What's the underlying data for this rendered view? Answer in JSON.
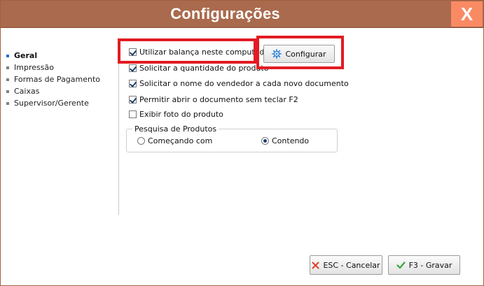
{
  "window": {
    "title": "Configurações",
    "close_label": "X"
  },
  "sidebar": {
    "items": [
      {
        "label": "Geral",
        "active": true
      },
      {
        "label": "Impressão",
        "active": false
      },
      {
        "label": "Formas de Pagamento",
        "active": false
      },
      {
        "label": "Caixas",
        "active": false
      },
      {
        "label": "Supervisor/Gerente",
        "active": false
      }
    ]
  },
  "options": [
    {
      "label": "Utilizar balança neste computador",
      "checked": true
    },
    {
      "label": "Solicitar a quantidade do produto",
      "checked": true
    },
    {
      "label": "Solicitar o nome do vendedor a cada novo documento",
      "checked": true
    },
    {
      "label": "Permitir abrir o documento sem teclar F2",
      "checked": true
    },
    {
      "label": "Exibir foto do produto",
      "checked": false
    }
  ],
  "configure_button": {
    "label": "Configurar",
    "icon": "gear-icon"
  },
  "search_group": {
    "legend": "Pesquisa de Produtos",
    "options": [
      {
        "label": "Começando com",
        "selected": false
      },
      {
        "label": "Contendo",
        "selected": true
      }
    ]
  },
  "footer": {
    "cancel_label": "ESC - Cancelar",
    "save_label": "F3 - Gravar"
  },
  "colors": {
    "title_bar": "#a96a4d",
    "close_button": "#fa8a64",
    "highlight_box": "#e31b23",
    "active_bullet": "#1f6fd0"
  }
}
